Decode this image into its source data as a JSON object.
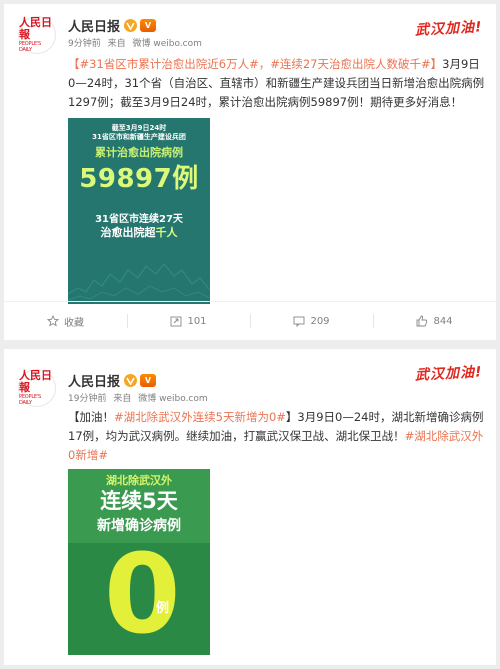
{
  "posts": [
    {
      "author": "人民日报",
      "logo_text": "人民日報",
      "logo_sub": "PEOPLE'S DAILY",
      "vip_badge": "V",
      "time": "9分钟前",
      "source_prefix": "来自",
      "source": "微博 weibo.com",
      "campaign": "武汉加油!",
      "text_link": "【#31省区市累计治愈出院近6万人#，#连续27天治愈出院人数破千#】",
      "text_body": "3月9日0—24时，31个省（自治区、直辖市）和新疆生产建设兵团当日新增治愈出院病例1297例；截至3月9日24时，累计治愈出院病例59897例！期待更多好消息！",
      "image": {
        "date_line1": "截至3月9日24时",
        "date_line2": "31省区市和新疆生产建设兵团",
        "label": "累计治愈出院病例",
        "number": "59897例",
        "sub1": "31省区市连续27天",
        "sub2_a": "治愈出院超",
        "sub2_b": "千人"
      },
      "actions": {
        "collect": "收藏",
        "repost": "101",
        "comment": "209",
        "like": "844"
      }
    },
    {
      "author": "人民日报",
      "logo_text": "人民日報",
      "logo_sub": "PEOPLE'S DAILY",
      "vip_badge": "V",
      "time": "19分钟前",
      "source_prefix": "来自",
      "source": "微博 weibo.com",
      "campaign": "武汉加油!",
      "text_prefix": "【加油！",
      "text_link": "#湖北除武汉外连续5天新增为0#",
      "text_middle": "】3月9日0—24时，湖北新增确诊病例17例，均为武汉病例。继续加油，打赢武汉保卫战、湖北保卫战！",
      "text_link2": "#湖北除武汉外0新增#",
      "image": {
        "line1": "湖北除武汉外",
        "line2": "连续5天",
        "line3": "新增确诊病例",
        "zero": "0",
        "unit": "例"
      }
    }
  ],
  "colors": {
    "link": "#eb7350",
    "campaign": "#e0281f",
    "img1_bg": "#25766e",
    "img2_bg": "#2a8a45",
    "highlight": "#dcfa7a"
  }
}
